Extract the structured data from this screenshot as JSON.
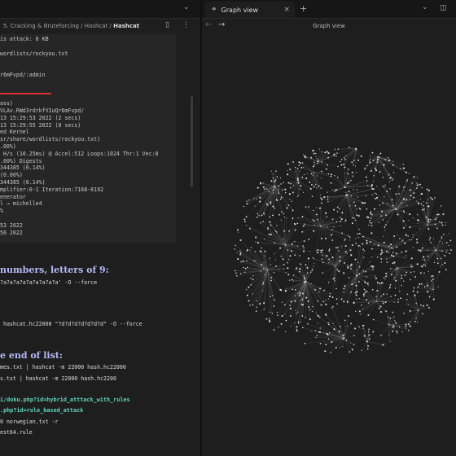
{
  "left_pane": {
    "breadcrumb": {
      "part1": "5. Cracking & Bruteforcing",
      "sep": "/",
      "part2": "Hashcat",
      "current": "Hashcat"
    },
    "code_lines": [
      "is attack: 0 KB",
      "",
      "wordlists/rockyou.txt",
      "",
      "",
      "r6mFvpd/:admin",
      "",
      "",
      "",
      "ass)",
      "VLAv.RWd3rdrkfVIuQr6mFvpd/",
      "13 15:29:53 2022 (2 secs)",
      "13 15:29:55 2022 (0 secs)",
      "ed Kernel",
      "sr/share/wordlists/rockyou.txt)",
      ".00%)",
      " H/s (10.25ms) @ Accel:512 Loops:1024 Thr:1 Vec:8",
      ".00%) Digests",
      "344385 (0.14%)",
      "(0.00%)",
      "344385 (0.14%)",
      "mplifier:0-1 Iteration:7168-8192",
      "enerator",
      "l → michelle4",
      "%",
      "",
      "53 2022",
      "56 2022"
    ],
    "heading_numbers": "numbers, letters of 9:",
    "cmd_mask1": "?a?a?a?a?a?a?a?a?a' -O --force",
    "cmd_mask2": " hashcat.hc22000 \"?d?d?d?d?d?d?d\" -O --force",
    "heading_endlist": "e end of list:",
    "cmd_names": "mes.txt | hashcat -m 22000 hash.hc22000",
    "cmd_lists": "s.txt | hashcat -m 22000 hash.hc2200",
    "link_hybrid": "i/doku.php?id=hybrid_atttack_with_rules",
    "link_rule": ".php?id=rule_based_attack",
    "cmd_norwegian": "0 norwegian.txt -r",
    "cmd_best64": "est64.rule"
  },
  "right_pane": {
    "tab_label": "Graph view",
    "tab_close": "×",
    "new_tab": "+",
    "title": "Graph view",
    "back_arrow": "←",
    "forward_arrow": "→"
  },
  "window_icons": {
    "left_chevron": "⌄",
    "right_chevron": "⌄",
    "sidebar_toggle": "◫",
    "bookmark": "▯",
    "more": "⋮"
  },
  "colors": {
    "background": "#1e1e1e",
    "code_bg": "#262626",
    "heading": "#b5b9f7",
    "link": "#5fd3bc",
    "underline_red": "#e03131",
    "graph_node": "#d8d8d8",
    "graph_edge": "#6e6e6e"
  }
}
